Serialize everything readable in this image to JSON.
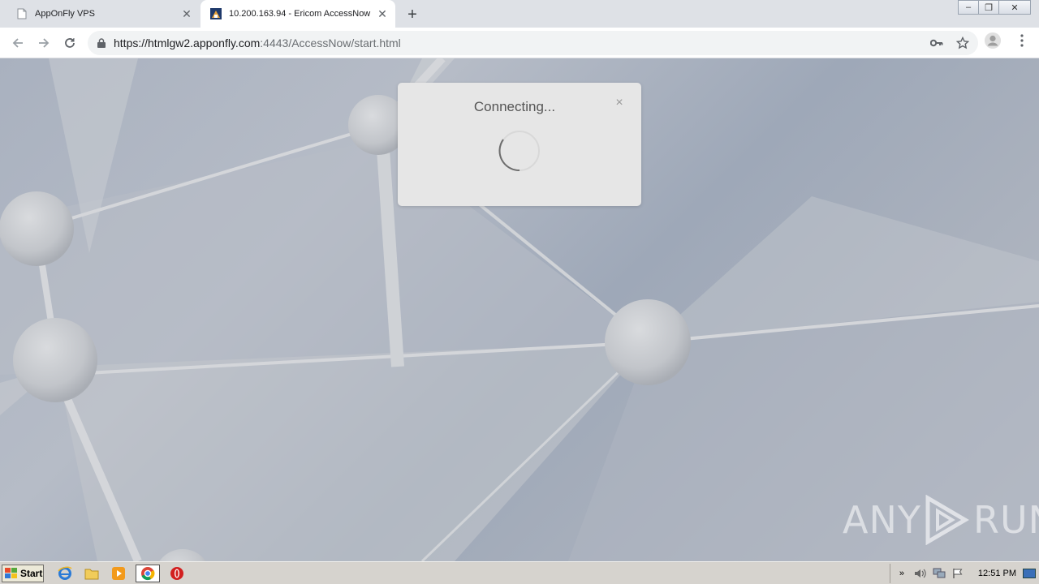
{
  "browser": {
    "tabs": [
      {
        "title": "AppOnFly VPS",
        "active": false,
        "icon": "page-icon"
      },
      {
        "title": "10.200.163.94 - Ericom AccessNow",
        "active": true,
        "icon": "ericom-icon"
      }
    ],
    "new_tab_label": "+",
    "url_host": "https://htmlgw2.apponfly.com",
    "url_rest": ":4443/AccessNow/start.html"
  },
  "dialog": {
    "title": "Connecting...",
    "close_label": "×"
  },
  "watermark": {
    "left": "ANY",
    "right": "RUN"
  },
  "taskbar": {
    "start_label": "Start",
    "clock": "12:51 PM",
    "tray_expand": "»"
  },
  "colors": {
    "tab_strip": "#dee1e6",
    "dialog_bg": "#e6e6e6",
    "taskbar": "#d6d3ce"
  }
}
